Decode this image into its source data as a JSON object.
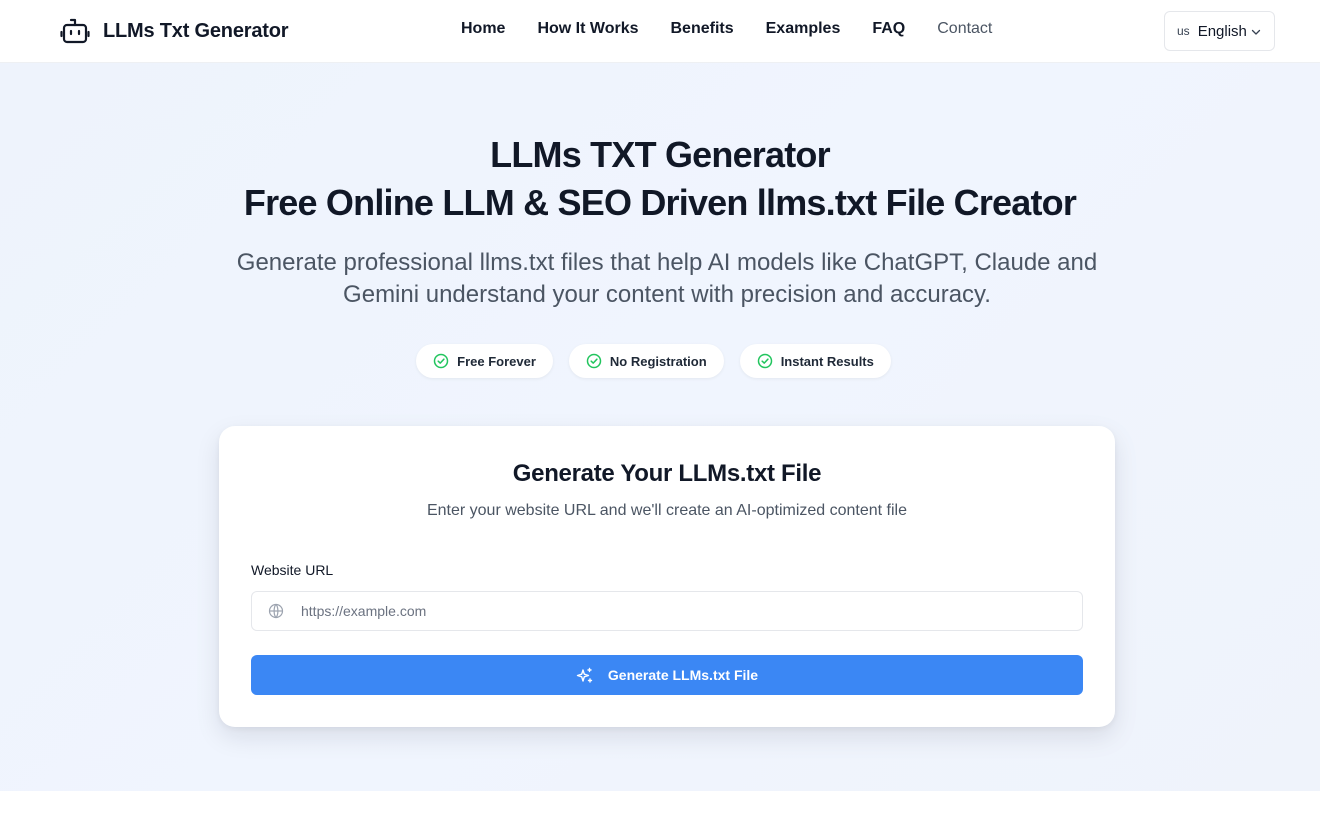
{
  "header": {
    "brand": "LLMs Txt Generator",
    "brand_icon": "robot-icon",
    "nav": [
      {
        "label": "Home"
      },
      {
        "label": "How It Works"
      },
      {
        "label": "Benefits"
      },
      {
        "label": "Examples"
      },
      {
        "label": "FAQ"
      },
      {
        "label": "Contact"
      }
    ],
    "language": {
      "flag": "us",
      "label": "English",
      "icon": "chevron-down-icon"
    }
  },
  "hero": {
    "title_line1": "LLMs TXT Generator",
    "title_line2": "Free Online LLM & SEO Driven llms.txt File Creator",
    "subtitle": "Generate professional llms.txt files that help AI models like ChatGPT, Claude and Gemini understand your content with precision and accuracy.",
    "badges": [
      {
        "label": "Free Forever",
        "icon": "check-circle-icon"
      },
      {
        "label": "No Registration",
        "icon": "check-circle-icon"
      },
      {
        "label": "Instant Results",
        "icon": "check-circle-icon"
      }
    ]
  },
  "form_card": {
    "title": "Generate Your LLMs.txt File",
    "subtitle": "Enter your website URL and we'll create an AI-optimized content file",
    "url_label": "Website URL",
    "url_placeholder": "https://example.com",
    "url_value": "",
    "submit_label": "Generate LLMs.txt File",
    "submit_icon": "sparkles-icon"
  },
  "colors": {
    "accent": "#3b87f4",
    "badge_check": "#22c55e",
    "hero_bg": "#eef3fc",
    "text_primary": "#111827",
    "text_secondary": "#4b5563"
  }
}
